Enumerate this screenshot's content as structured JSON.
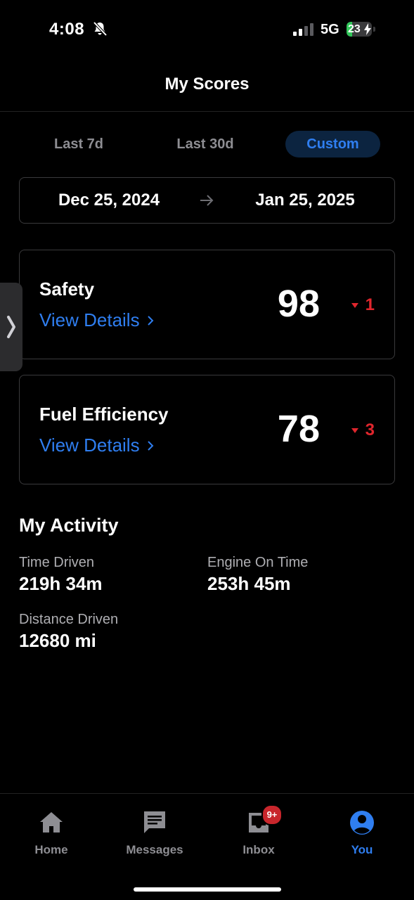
{
  "status_bar": {
    "time": "4:08",
    "network": "5G",
    "battery_level": "23",
    "battery_fraction": 0.23
  },
  "header": {
    "title": "My Scores"
  },
  "tabs": [
    {
      "label": "Last 7d",
      "selected": false
    },
    {
      "label": "Last 30d",
      "selected": false
    },
    {
      "label": "Custom",
      "selected": true
    }
  ],
  "date_range": {
    "start": "Dec 25, 2024",
    "end": "Jan 25, 2025"
  },
  "scores": [
    {
      "title": "Safety",
      "link": "View Details",
      "value": "98",
      "delta": "1",
      "trend": "down"
    },
    {
      "title": "Fuel Efficiency",
      "link": "View Details",
      "value": "78",
      "delta": "3",
      "trend": "down"
    }
  ],
  "activity": {
    "title": "My Activity",
    "stats": [
      {
        "label": "Time Driven",
        "value": "219h 34m"
      },
      {
        "label": "Engine On Time",
        "value": "253h 45m"
      },
      {
        "label": "Distance Driven",
        "value": "12680 mi"
      }
    ]
  },
  "tabbar": {
    "items": [
      {
        "label": "Home",
        "icon": "home-icon"
      },
      {
        "label": "Messages",
        "icon": "messages-icon"
      },
      {
        "label": "Inbox",
        "icon": "inbox-icon",
        "badge": "9+"
      },
      {
        "label": "You",
        "icon": "user-icon",
        "active": true
      }
    ]
  },
  "colors": {
    "accent": "#2f7ef0",
    "negative": "#e0262d",
    "background": "#000000",
    "badge": "#c8262c"
  }
}
